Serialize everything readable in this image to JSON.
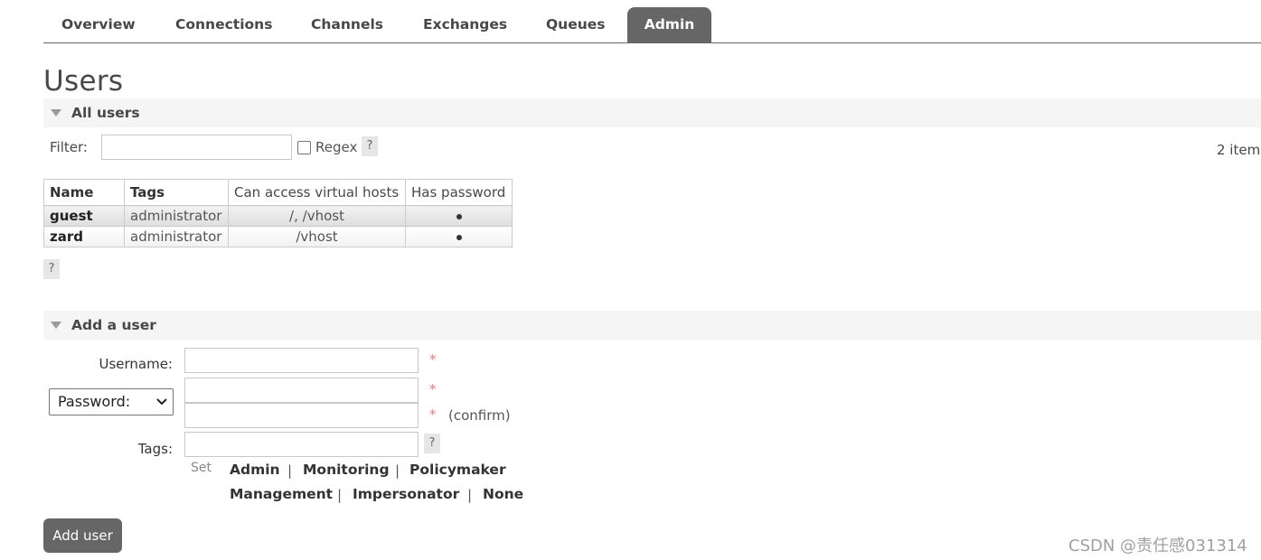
{
  "nav": {
    "tabs": [
      {
        "label": "Overview"
      },
      {
        "label": "Connections"
      },
      {
        "label": "Channels"
      },
      {
        "label": "Exchanges"
      },
      {
        "label": "Queues"
      },
      {
        "label": "Admin",
        "active": true
      }
    ]
  },
  "page": {
    "title": "Users"
  },
  "all_users": {
    "header": "All users",
    "filter_label": "Filter:",
    "filter_value": "",
    "regex_label": "Regex",
    "regex_checked": false,
    "help_label": "?",
    "item_count": "2 item",
    "columns": [
      "Name",
      "Tags",
      "Can access virtual hosts",
      "Has password"
    ],
    "rows": [
      {
        "name": "guest",
        "tags": "administrator",
        "vhosts": "/, /vhost",
        "has_password": "•"
      },
      {
        "name": "zard",
        "tags": "administrator",
        "vhosts": "/vhost",
        "has_password": "•"
      }
    ],
    "table_help": "?"
  },
  "add_user": {
    "header": "Add a user",
    "username_label": "Username:",
    "username_value": "",
    "password_mode": "Password:",
    "password_value": "",
    "confirm_value": "",
    "required_mark": "*",
    "confirm_label": "(confirm)",
    "tags_label": "Tags:",
    "tags_value": "",
    "tags_help": "?",
    "set_label": "Set",
    "tag_options_row1": [
      "Admin",
      "Monitoring",
      "Policymaker"
    ],
    "tag_options_row2": [
      "Management",
      "Impersonator",
      "None"
    ],
    "separator": "|",
    "submit_label": "Add user"
  },
  "watermark": "CSDN @责任感031314",
  "colors": {
    "tab_active_bg": "#666666",
    "section_bg": "#f5f5f5",
    "required": "#e87c7c",
    "button_bg": "#666666"
  }
}
